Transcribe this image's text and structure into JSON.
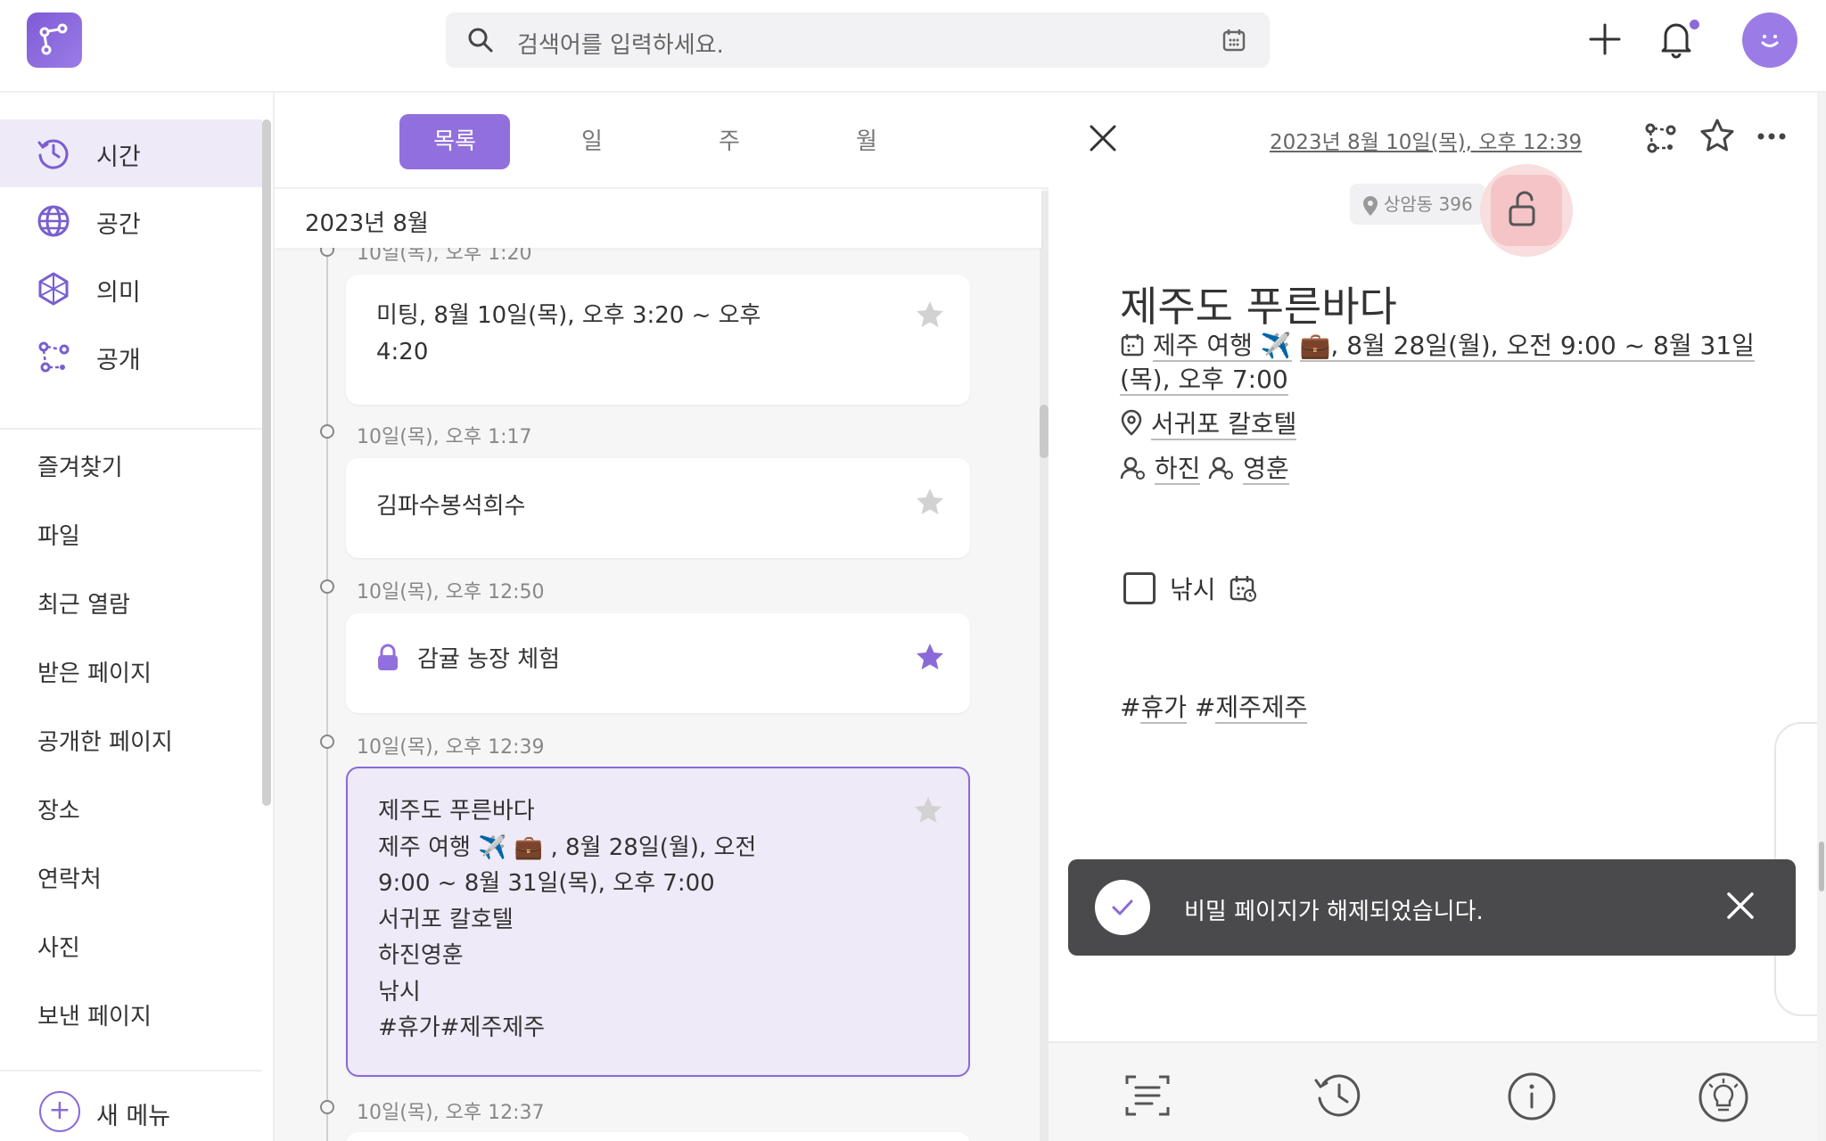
{
  "topbar": {
    "search_placeholder": "검색어를 입력하세요.",
    "icons": [
      "logo-icon",
      "search-icon",
      "calendar-icon",
      "plus-icon",
      "bell-icon",
      "avatar"
    ]
  },
  "sidebar": {
    "nav": [
      {
        "label": "시간",
        "icon": "clock-history-icon",
        "active": true
      },
      {
        "label": "공간",
        "icon": "globe-icon",
        "active": false
      },
      {
        "label": "의미",
        "icon": "hexagon-icon",
        "active": false
      },
      {
        "label": "공개",
        "icon": "network-icon",
        "active": false
      }
    ],
    "menus": [
      "즐겨찾기",
      "파일",
      "최근 열람",
      "받은 페이지",
      "공개한 페이지",
      "장소",
      "연락처",
      "사진",
      "보낸 페이지"
    ],
    "new_menu": "새 메뉴"
  },
  "list": {
    "tabs": [
      "목록",
      "일",
      "주",
      "월"
    ],
    "active_tab": "목록",
    "month": "2023년 8월",
    "entries": [
      {
        "time": "10일(목), 오후 1:20",
        "text": "미팅, 8월 10일(목), 오후 3:20 ~ 오후\n4:20",
        "starred": false,
        "locked": false,
        "selected": false
      },
      {
        "time": "10일(목), 오후 1:17",
        "text": "김파수봉석희수",
        "starred": false,
        "locked": false,
        "selected": false
      },
      {
        "time": "10일(목), 오후 12:50",
        "text": "감귤 농장 체험",
        "starred": true,
        "locked": true,
        "selected": false
      },
      {
        "time": "10일(목), 오후 12:39",
        "text": "제주도 푸른바다\n제주 여행 ✈️ 💼 , 8월 28일(월), 오전\n9:00 ~ 8월 31일(목), 오후 7:00\n서귀포 칼호텔\n하진영훈\n낚시\n#휴가#제주제주",
        "starred": false,
        "locked": false,
        "selected": true
      },
      {
        "time": "10일(목), 오후 12:37",
        "text": "",
        "starred": false,
        "locked": false,
        "selected": false
      }
    ]
  },
  "detail": {
    "date": "2023년 8월 10일(목), 오후 12:39",
    "location_pill": "상암동 396",
    "title": "제주도 푸른바다",
    "event_line1_a": "제주 여행 ✈️",
    "event_line1_b": "💼",
    "event_line1_c": ", 8월 28일(월), 오전 9:00 ~ 8월 31일",
    "event_line2": "(목), 오후 7:00",
    "place": "서귀포 칼호텔",
    "person1": "하진",
    "person2": "영훈",
    "todo": "낚시",
    "tag1": "휴가",
    "tag2": "제주제주",
    "hash": "#",
    "toast": "비밀 페이지가 해제되었습니다."
  },
  "colors": {
    "accent": "#9170dd",
    "selected_bg": "#efeaf8",
    "toast_bg": "#4a4a4c",
    "lock_bg": "#f4c4c6"
  }
}
